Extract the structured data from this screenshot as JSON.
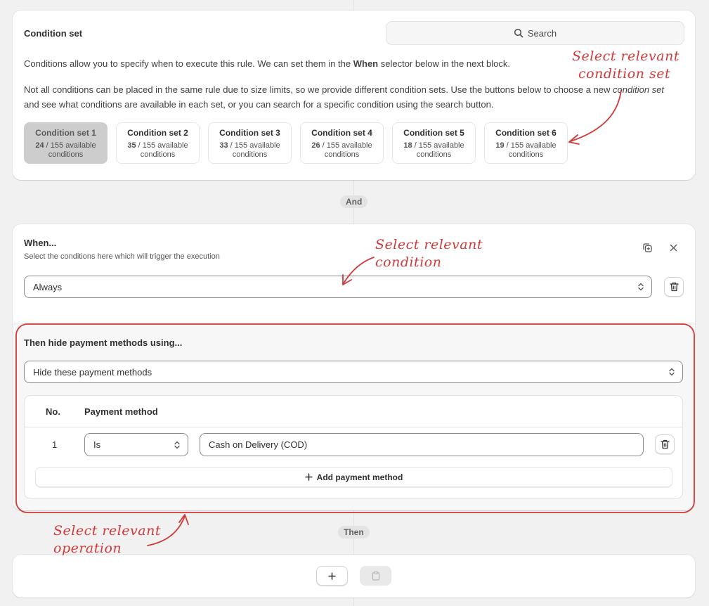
{
  "condition_set_card": {
    "title": "Condition set",
    "search_label": "Search",
    "para1_pre": "Conditions allow you to specify when to execute this rule. We can set them in the ",
    "para1_bold": "When",
    "para1_post": " selector below in the next block.",
    "para2_pre": "Not all conditions can be placed in the same rule due to size limits, so we provide different condition sets. Use the buttons below to choose a new ",
    "para2_em": "condition set",
    "para2_post": " and see what conditions are available in each set, or you can search for a specific condition using the search button.",
    "sets": [
      {
        "name": "Condition set 1",
        "count": "24",
        "total": " / 155 available",
        "unit": "conditions",
        "active": true
      },
      {
        "name": "Condition set 2",
        "count": "35",
        "total": " / 155 available",
        "unit": "conditions",
        "active": false
      },
      {
        "name": "Condition set 3",
        "count": "33",
        "total": " / 155 available",
        "unit": "conditions",
        "active": false
      },
      {
        "name": "Condition set 4",
        "count": "26",
        "total": " / 155 available",
        "unit": "conditions",
        "active": false
      },
      {
        "name": "Condition set 5",
        "count": "18",
        "total": " / 155 available",
        "unit": "conditions",
        "active": false
      },
      {
        "name": "Condition set 6",
        "count": "19",
        "total": " / 155 available",
        "unit": "conditions",
        "active": false
      }
    ]
  },
  "and_label": "And",
  "when_card": {
    "title": "When...",
    "subtitle": "Select the conditions here which will trigger the execution",
    "condition_value": "Always",
    "then_title": "Then hide payment methods using...",
    "operation_value": "Hide these payment methods",
    "table": {
      "col_no": "No.",
      "col_method": "Payment method",
      "rows": [
        {
          "no": "1",
          "operator": "Is",
          "value": "Cash on Delivery (COD)"
        }
      ],
      "add_label": "Add payment method"
    }
  },
  "then_label": "Then",
  "annotations": {
    "condition_set": [
      "Select relevant",
      "condition set"
    ],
    "condition": [
      "Select relevant",
      "condition"
    ],
    "operation": [
      "Select relevant",
      "operation"
    ]
  },
  "colors": {
    "annotation": "#d03a3a",
    "active_set_bg": "#cdcdcd",
    "page_bg": "#f1f1f1"
  },
  "icons": [
    "search-icon",
    "duplicate-icon",
    "close-icon",
    "trash-icon",
    "chevron-updown-icon",
    "plus-icon",
    "clipboard-icon"
  ]
}
